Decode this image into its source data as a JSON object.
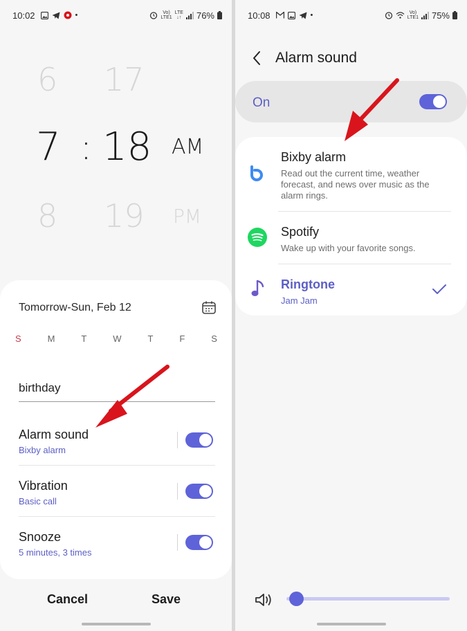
{
  "left": {
    "status": {
      "time": "10:02",
      "battery": "76%"
    },
    "picker": {
      "hour_above": "6",
      "minute_above": "17",
      "hour": "7",
      "colon": ":",
      "minute": "18",
      "ampm": "AM",
      "hour_below": "8",
      "minute_below": "19",
      "ampm_below": "PM"
    },
    "date": "Tomorrow-Sun, Feb 12",
    "days": [
      "S",
      "M",
      "T",
      "W",
      "T",
      "F",
      "S"
    ],
    "alarm_name": "birthday",
    "settings": [
      {
        "title": "Alarm sound",
        "sub": "Bixby alarm",
        "on": true
      },
      {
        "title": "Vibration",
        "sub": "Basic call",
        "on": true
      },
      {
        "title": "Snooze",
        "sub": "5 minutes, 3 times",
        "on": true
      }
    ],
    "buttons": {
      "cancel": "Cancel",
      "save": "Save"
    }
  },
  "right": {
    "status": {
      "time": "10:08",
      "battery": "75%"
    },
    "header": {
      "title": "Alarm sound"
    },
    "master": {
      "label": "On",
      "on": true
    },
    "options": [
      {
        "title": "Bixby alarm",
        "desc": "Read out the current time, weather forecast, and news over music as the alarm rings.",
        "icon": "bixby-icon"
      },
      {
        "title": "Spotify",
        "desc": "Wake up with your favorite songs.",
        "icon": "spotify-icon"
      },
      {
        "title": "Ringtone",
        "desc": "Jam Jam",
        "icon": "music-note-icon",
        "selected": true
      }
    ],
    "volume": {
      "level": 0.02
    }
  },
  "colors": {
    "accent": "#5e63d9",
    "accent_text": "#5d5fc5",
    "arrow": "#d9141c",
    "sunday": "#c93a4a",
    "spotify": "#1ed760",
    "bixby": "#3e8bf0"
  }
}
